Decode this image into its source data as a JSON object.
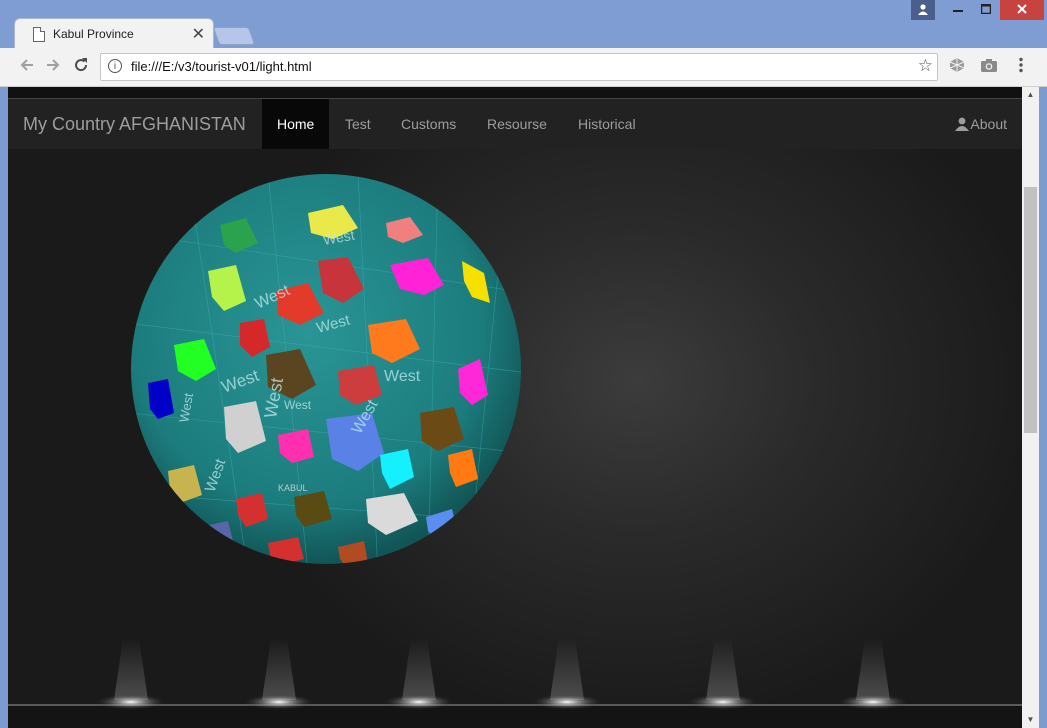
{
  "browser": {
    "tab_title": "Kabul Province",
    "tab_close": "✕",
    "url": "file:///E:/v3/tourist-v01/light.html"
  },
  "navbar": {
    "brand": "My Country AFGHANISTAN",
    "items": [
      "Home",
      "Test",
      "Customs",
      "Resourse",
      "Historical"
    ],
    "active": "Home",
    "about": "About"
  },
  "globe": {
    "labels": [
      "West",
      "West",
      "West",
      "West",
      "West",
      "West",
      "West",
      "West",
      "West",
      "West",
      "KABUL"
    ]
  },
  "colors": {
    "globe_base": "#1c7f80",
    "navbar_bg": "#222222",
    "active_nav_bg": "#080808",
    "window_chrome": "#7f9dd2",
    "close_button": "#c7433f"
  },
  "icons": [
    "page-icon",
    "close-icon",
    "back-icon",
    "forward-icon",
    "reload-icon",
    "info-icon",
    "star-icon",
    "extension-icon",
    "camera-icon",
    "menu-icon",
    "user-icon"
  ]
}
